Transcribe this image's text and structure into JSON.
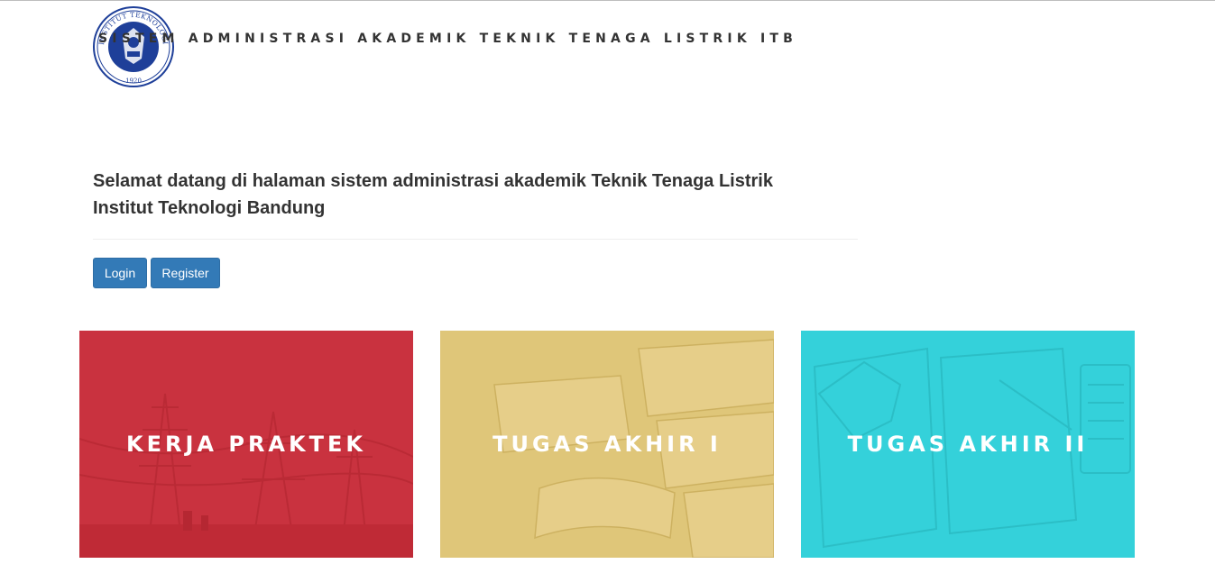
{
  "header": {
    "logo_alt": "Institut Teknologi Bandung 1920 seal",
    "logo_ring_text": "INSTITUT TEKNOLOGI BANDUNG",
    "logo_year": "1920",
    "title": "SISTEM ADMINISTRASI AKADEMIK TEKNIK TENAGA LISTRIK ITB"
  },
  "welcome": {
    "line1": "Selamat datang di halaman sistem administrasi akademik Teknik Tenaga Listrik",
    "line2": "Institut Teknologi Bandung"
  },
  "actions": {
    "login_label": "Login",
    "register_label": "Register"
  },
  "cards": [
    {
      "label": "KERJA PRAKTEK",
      "color": "#c9323f",
      "icon": "power-lines-image"
    },
    {
      "label": "TUGAS AKHIR I",
      "color": "#dfc679",
      "icon": "books-image"
    },
    {
      "label": "TUGAS AKHIR II",
      "color": "#34d1da",
      "icon": "notebook-calculator-image"
    }
  ],
  "colors": {
    "primary_button": "#337ab7",
    "text": "#333333"
  }
}
